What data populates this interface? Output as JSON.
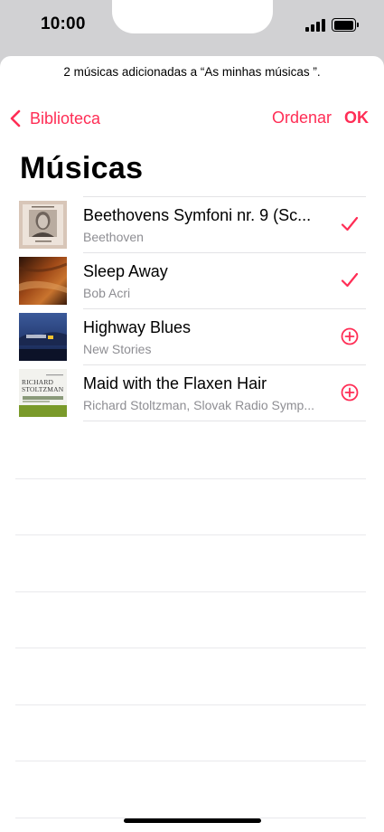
{
  "status_bar": {
    "time": "10:00"
  },
  "banner": {
    "text": "2 músicas adicionadas a “As minhas músicas ”."
  },
  "nav": {
    "back_label": "Biblioteca",
    "sort_label": "Ordenar",
    "done_label": "OK"
  },
  "page": {
    "title": "Músicas"
  },
  "songs": [
    {
      "title": "Beethovens Symfoni nr. 9 (Sc...",
      "artist": "Beethoven",
      "added": true,
      "art": "beethoven-cover"
    },
    {
      "title": "Sleep Away",
      "artist": "Bob Acri",
      "added": true,
      "art": "sleep-away-cover"
    },
    {
      "title": "Highway Blues",
      "artist": "New Stories",
      "added": false,
      "art": "highway-blues-cover"
    },
    {
      "title": "Maid with the Flaxen Hair",
      "artist": "Richard Stoltzman, Slovak Radio Symp...",
      "added": false,
      "art": "stoltzman-cover",
      "art_text": "RICHARD STOLTZMAN"
    }
  ],
  "colors": {
    "accent": "#ff2d55",
    "secondary_text": "#8e8e93"
  }
}
